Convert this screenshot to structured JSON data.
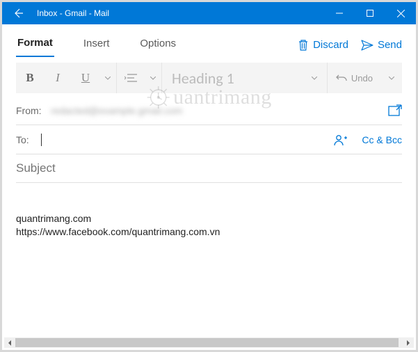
{
  "window": {
    "title": "Inbox - Gmail - Mail"
  },
  "tabs": {
    "items": [
      {
        "label": "Format",
        "active": true
      },
      {
        "label": "Insert",
        "active": false
      },
      {
        "label": "Options",
        "active": false
      }
    ]
  },
  "actions": {
    "discard": "Discard",
    "send": "Send"
  },
  "toolbar": {
    "bold": "B",
    "italic": "I",
    "underline": "U",
    "heading_style": "Heading 1",
    "undo": "Undo"
  },
  "fields": {
    "from_label": "From:",
    "from_value": "redacted@example.gmail.com",
    "to_label": "To:",
    "to_value": "",
    "cc_bcc": "Cc & Bcc",
    "subject_placeholder": "Subject",
    "subject_value": ""
  },
  "body": {
    "line1": "quantrimang.com",
    "line2": "https://www.facebook.com/quantrimang.com.vn"
  },
  "watermark": "uantrimang",
  "colors": {
    "accent": "#0078d7"
  }
}
